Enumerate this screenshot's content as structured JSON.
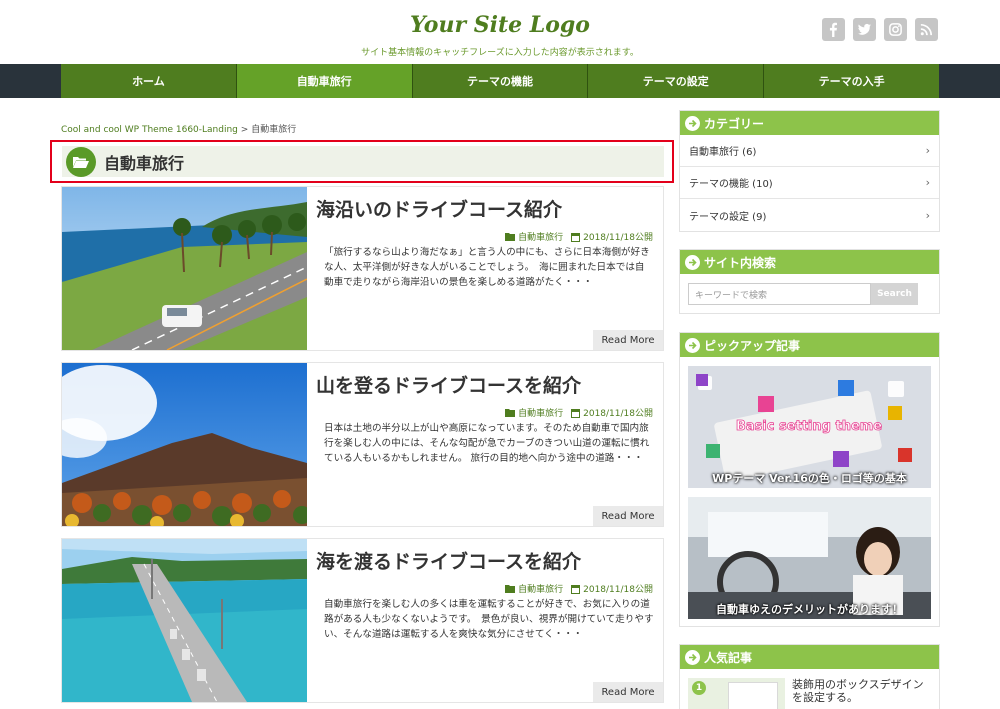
{
  "header": {
    "logo_text": "Your Site Logo",
    "tagline": "サイト基本情報のキャッチフレーズに入力した内容が表示されます。"
  },
  "social": [
    "facebook-icon",
    "twitter-icon",
    "instagram-icon",
    "rss-icon"
  ],
  "nav": {
    "items": [
      {
        "label": "ホーム"
      },
      {
        "label": "自動車旅行"
      },
      {
        "label": "テーマの機能"
      },
      {
        "label": "テーマの設定"
      },
      {
        "label": "テーマの入手"
      }
    ],
    "active_index": 1
  },
  "breadcrumb": {
    "home": "Cool and cool WP Theme 1660-Landing",
    "separator": ">",
    "current": "自動車旅行"
  },
  "category_title": "自動車旅行",
  "posts": [
    {
      "title": "海沿いのドライブコース紹介",
      "category": "自動車旅行",
      "date": "2018/11/18公開",
      "excerpt": "「旅行するなら山より海だなぁ」と言う人の中にも、さらに日本海側が好きな人、太平洋側が好きな人がいることでしょう。　海に囲まれた日本では自動車で走りながら海岸沿いの景色を楽しめる道路がたく・・・",
      "readmore": "Read More"
    },
    {
      "title": "山を登るドライブコースを紹介",
      "category": "自動車旅行",
      "date": "2018/11/18公開",
      "excerpt": "日本は土地の半分以上が山や高原になっています。そのため自動車で国内旅行を楽しむ人の中には、そんな勾配が急でカーブのきつい山道の運転に慣れている人もいるかもしれません。 旅行の目的地へ向かう途中の道路・・・",
      "readmore": "Read More"
    },
    {
      "title": "海を渡るドライブコースを紹介",
      "category": "自動車旅行",
      "date": "2018/11/18公開",
      "excerpt": "自動車旅行を楽しむ人の多くは車を運転することが好きで、お気に入りの道路がある人も少なくないようです。　景色が良い、視界が開けていて走りやすい、そんな道路は運転する人を爽快な気分にさせてく・・・",
      "readmore": "Read More"
    }
  ],
  "sidebar": {
    "categories": {
      "title": "カテゴリー",
      "items": [
        {
          "label": "自動車旅行 (6)"
        },
        {
          "label": "テーマの機能 (10)"
        },
        {
          "label": "テーマの設定 (9)"
        }
      ]
    },
    "search": {
      "title": "サイト内検索",
      "placeholder": "キーワードで検索",
      "button": "Search"
    },
    "pickup": {
      "title": "ピックアップ記事",
      "items": [
        {
          "overlay": "Basic setting theme",
          "caption": "WPテーマ Ver.16の色・ロゴ等の基本"
        },
        {
          "caption": "自動車ゆえのデメリットがあります！"
        }
      ]
    },
    "popular": {
      "title": "人気記事",
      "items": [
        {
          "rank": "1",
          "title": "装飾用のボックスデザインを設定する。"
        }
      ]
    }
  },
  "colors": {
    "brand_green": "#65a228",
    "nav_green": "#4f7d1f",
    "widget_green": "#8dc34a",
    "highlight_red": "#e3001b"
  }
}
